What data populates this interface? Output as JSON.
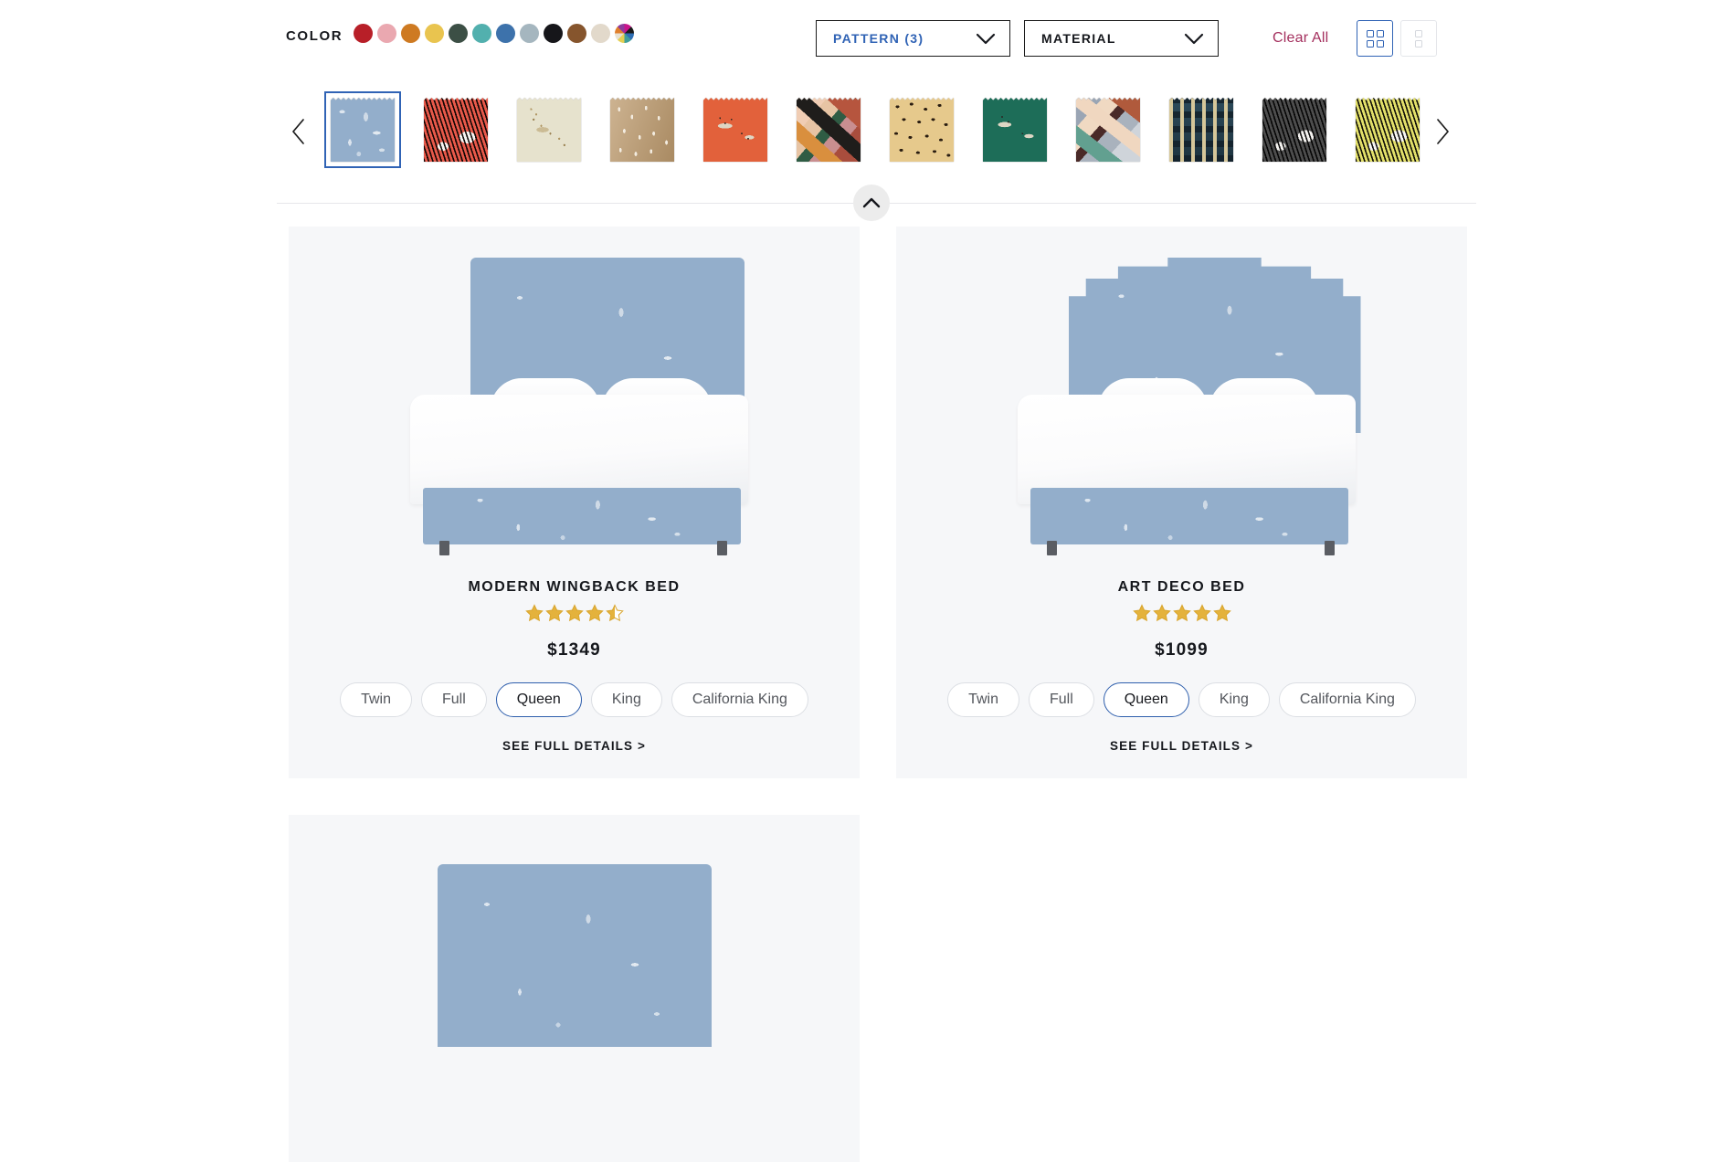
{
  "filter_bar": {
    "color_label": "COLOR",
    "color_swatches": [
      {
        "name": "red",
        "hex": "#b81f28"
      },
      {
        "name": "pink",
        "hex": "#eaa8b0"
      },
      {
        "name": "orange",
        "hex": "#ce7a22"
      },
      {
        "name": "yellow",
        "hex": "#e9c44f"
      },
      {
        "name": "dark-green",
        "hex": "#3c4f45"
      },
      {
        "name": "teal",
        "hex": "#52b0ae"
      },
      {
        "name": "blue",
        "hex": "#3d72ab"
      },
      {
        "name": "light-blue-gray",
        "hex": "#a5b6bf"
      },
      {
        "name": "black",
        "hex": "#16161a"
      },
      {
        "name": "brown",
        "hex": "#86552d"
      },
      {
        "name": "cream",
        "hex": "#e2d9cb"
      },
      {
        "name": "multicolor",
        "hex": "multi"
      }
    ],
    "dropdowns": [
      {
        "label": "PATTERN (3)",
        "active": true
      },
      {
        "label": "MATERIAL",
        "active": false
      }
    ],
    "clear_all_label": "Clear All",
    "clear_all_color": "#a4305e",
    "accent_blue": "#3063b5",
    "view_modes": [
      {
        "name": "grid-view",
        "active": true
      },
      {
        "name": "list-view",
        "active": false
      }
    ]
  },
  "pattern_strip": {
    "prev_arrow": "‹",
    "next_arrow": "›",
    "swatches": [
      {
        "name": "blue-toile-birds",
        "css": "p-toile-blue",
        "selected": true
      },
      {
        "name": "red-zebra",
        "css": "p-zebra-red",
        "selected": false
      },
      {
        "name": "cream-cheetah",
        "css": "p-cheetah-cream",
        "selected": false
      },
      {
        "name": "tan-dots",
        "css": "p-dots-tan",
        "selected": false
      },
      {
        "name": "orange-cheetah",
        "css": "p-cheetah-orange",
        "selected": false
      },
      {
        "name": "warm-geometric",
        "css": "p-geo-warm",
        "selected": false
      },
      {
        "name": "leopard-print",
        "css": "p-leopard",
        "selected": false
      },
      {
        "name": "green-cheetah",
        "css": "p-cheetah-green",
        "selected": false
      },
      {
        "name": "cool-geometric",
        "css": "p-geo-cool",
        "selected": false
      },
      {
        "name": "indigo-ikat",
        "css": "p-indigo-ikat",
        "selected": false
      },
      {
        "name": "gray-zebra",
        "css": "p-zebra-gray",
        "selected": false
      },
      {
        "name": "yellow-zebra",
        "css": "p-zebra-yellow",
        "selected": false
      }
    ]
  },
  "collapse_button": {
    "name": "collapse-filters",
    "icon": "chevron-up-icon"
  },
  "products": [
    {
      "title": "MODERN WINGBACK BED",
      "price": "$1349",
      "rating": 4.5,
      "rating_max": 5,
      "style": "wingback",
      "fabric": "blue-toile-birds",
      "sizes": [
        {
          "label": "Twin",
          "selected": false
        },
        {
          "label": "Full",
          "selected": false
        },
        {
          "label": "Queen",
          "selected": true
        },
        {
          "label": "King",
          "selected": false
        },
        {
          "label": "California King",
          "selected": false
        }
      ],
      "details_label": "SEE FULL DETAILS >"
    },
    {
      "title": "ART DECO BED",
      "price": "$1099",
      "rating": 5,
      "rating_max": 5,
      "style": "artdeco",
      "fabric": "blue-toile-birds",
      "sizes": [
        {
          "label": "Twin",
          "selected": false
        },
        {
          "label": "Full",
          "selected": false
        },
        {
          "label": "Queen",
          "selected": true
        },
        {
          "label": "King",
          "selected": false
        },
        {
          "label": "California King",
          "selected": false
        }
      ],
      "details_label": "SEE FULL DETAILS >"
    }
  ],
  "partial_product": {
    "style": "headboard-only",
    "fabric": "blue-toile-birds"
  }
}
